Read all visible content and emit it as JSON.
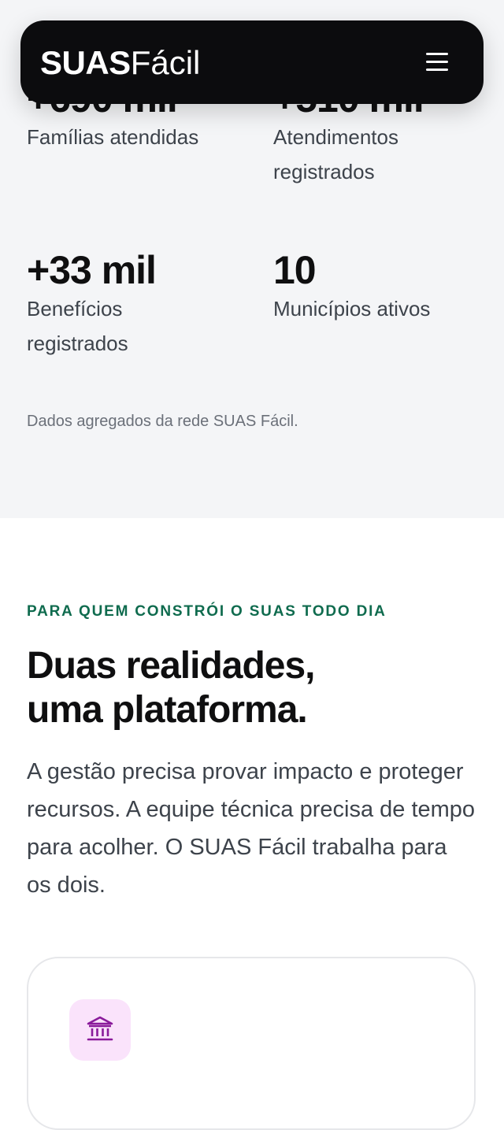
{
  "brand": {
    "strong": "SUAS",
    "light": "Fácil"
  },
  "menu": {
    "icon": "hamburger-menu-icon"
  },
  "stats": [
    {
      "value": "+690 mil",
      "label": "Famílias atendidas"
    },
    {
      "value": "+510 mil",
      "label": "Atendimentos registrados"
    },
    {
      "value": "+33 mil",
      "label": "Benefícios registrados"
    },
    {
      "value": "10",
      "label": "Municípios ativos"
    }
  ],
  "stats_note": "Dados agregados da rede SUAS Fácil.",
  "section": {
    "eyebrow": "PARA QUEM CONSTRÓI O SUAS TODO DIA",
    "heading_line1": "Duas realidades,",
    "heading_line2": "uma plataforma.",
    "intro": "A gestão precisa provar impacto e proteger recursos. A equipe técnica precisa de tempo para acolher. O SUAS Fácil trabalha para os dois."
  },
  "card": {
    "icon": "institution-icon",
    "icon_color": "#8a1b9b",
    "icon_bg": "#fae3fb"
  },
  "colors": {
    "accent_green": "#0f6b4e",
    "navbar_bg": "#0c0c0e",
    "stats_bg": "#f4f5f7"
  }
}
